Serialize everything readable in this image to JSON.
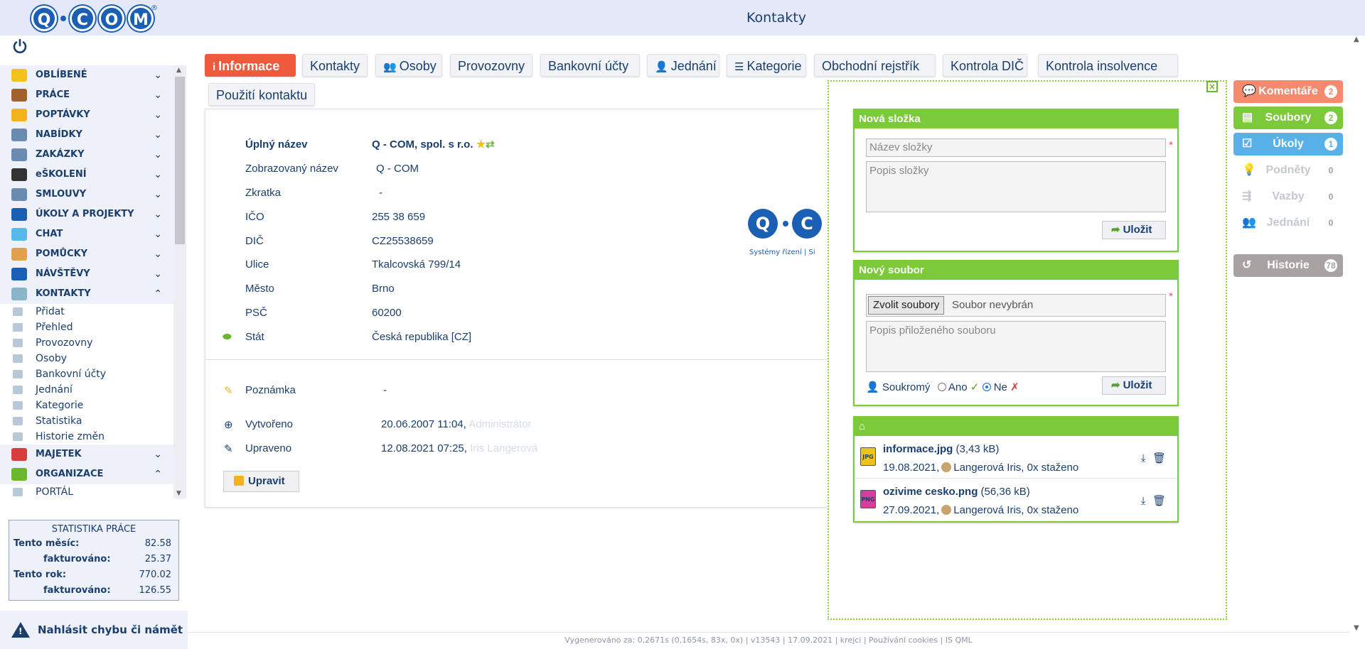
{
  "header": {
    "title": "Kontakty",
    "logo_text": "Q·COM"
  },
  "sidebar": {
    "items": [
      {
        "label": "OBLÍBENÉ",
        "icon": "star-icon",
        "color": "#f2c21c",
        "chev": "⌄"
      },
      {
        "label": "PRÁCE",
        "icon": "briefcase-icon",
        "color": "#a0622c",
        "chev": "⌄"
      },
      {
        "label": "POPTÁVKY",
        "icon": "bulb-icon",
        "color": "#f2b41c",
        "chev": "⌄"
      },
      {
        "label": "NABÍDKY",
        "icon": "clipboard-icon",
        "color": "#6a8ab0",
        "chev": "⌄"
      },
      {
        "label": "ZAKÁZKY",
        "icon": "toolbox-icon",
        "color": "#6a8ab0",
        "chev": "⌄"
      },
      {
        "label": "eŠKOLENÍ",
        "icon": "graduation-cap-icon",
        "color": "#333333",
        "chev": "⌄"
      },
      {
        "label": "SMLOUVY",
        "icon": "handshake-icon",
        "color": "#6a8ab0",
        "chev": "⌄"
      },
      {
        "label": "ÚKOLY A PROJEKTY",
        "icon": "task-icon",
        "color": "#1a5fb4",
        "chev": "⌄"
      },
      {
        "label": "CHAT",
        "icon": "chat-icon",
        "color": "#58b8e8",
        "chev": "⌄"
      },
      {
        "label": "POMŮCKY",
        "icon": "archive-icon",
        "color": "#e0a04c",
        "chev": "⌄"
      },
      {
        "label": "NÁVŠTĚVY",
        "icon": "walker-icon",
        "color": "#1a5fb4",
        "chev": "⌄"
      },
      {
        "label": "KONTAKTY",
        "icon": "contacts-icon",
        "color": "#8ab4c8",
        "chev": "⌃"
      }
    ],
    "kontakty_sub": [
      "Přidat",
      "Přehled",
      "Provozovny",
      "Osoby",
      "Bankovní účty",
      "Jednání",
      "Kategorie",
      "Statistika",
      "Historie změn"
    ],
    "items2": [
      {
        "label": "MAJETEK",
        "icon": "armchair-icon",
        "color": "#d83c3c",
        "chev": "⌄"
      },
      {
        "label": "ORGANIZACE",
        "icon": "cube-icon",
        "color": "#6cb82a",
        "chev": "⌃"
      }
    ],
    "org_sub": [
      "PORTÁL"
    ]
  },
  "stats": {
    "heading": "STATISTIKA PRÁCE",
    "month_label": "Tento měsíc:",
    "month_value": "82.58",
    "month_inv_label": "fakturováno:",
    "month_inv_value": "25.37",
    "year_label": "Tento rok:",
    "year_value": "770.02",
    "year_inv_label": "fakturováno:",
    "year_inv_value": "126.55"
  },
  "report": {
    "label": "Nahlásit chybu či námět"
  },
  "tabs": [
    {
      "label": "Informace",
      "icon": "i",
      "active": true
    },
    {
      "label": "Kontakty",
      "icon": ""
    },
    {
      "label": "Osoby",
      "icon": "👥"
    },
    {
      "label": "Provozovny",
      "icon": ""
    },
    {
      "label": "Bankovní účty",
      "icon": ""
    },
    {
      "label": "Jednání",
      "icon": "👤"
    },
    {
      "label": "Kategorie",
      "icon": "☰"
    },
    {
      "label": "Obchodní rejstřík",
      "icon": ""
    },
    {
      "label": "Kontrola DIČ",
      "icon": ""
    },
    {
      "label": "Kontrola insolvence",
      "icon": ""
    },
    {
      "label": "Použití kontaktu",
      "icon": ""
    }
  ],
  "info": {
    "full_name_label": "Úplný název",
    "full_name": "Q - COM, spol. s r.o.",
    "display_name_label": "Zobrazovaný název",
    "display_name": "Q - COM",
    "abbr_label": "Zkratka",
    "abbr": "-",
    "ico_label": "IČO",
    "ico": "255 38 659",
    "dic_label": "DIČ",
    "dic": "CZ25538659",
    "street_label": "Ulice",
    "street": "Tkalcovská 799/14",
    "city_label": "Město",
    "city": "Brno",
    "zip_label": "PSČ",
    "zip": "60200",
    "country_label": "Stát",
    "country": "Česká republika [CZ]",
    "logo_caption": "Systémy řízení | Si",
    "note_label": "Poznámka",
    "note": "-",
    "created_label": "Vytvořeno",
    "created": "20.06.2007 11:04,",
    "created_by": "Administrátor",
    "updated_label": "Upraveno",
    "updated": "12.08.2021 07:25,",
    "updated_by": "Iris Langerová",
    "edit_button": "Upravit"
  },
  "panel": {
    "new_folder": {
      "title": "Nová složka",
      "name_placeholder": "Název složky",
      "desc_placeholder": "Popis složky",
      "save": "Uložit"
    },
    "new_file": {
      "title": "Nový soubor",
      "choose": "Zvolit soubory",
      "no_file": "Soubor nevybrán",
      "desc_placeholder": "Popis přiloženého souboru",
      "private_label": "Soukromý",
      "yes": "Ano",
      "no": "Ne",
      "save": "Uložit"
    },
    "files": [
      {
        "name": "informace.jpg",
        "size": "(3,43 kB)",
        "date": "19.08.2021,",
        "user": "Langerová Iris, 0x staženo",
        "type": "JPG",
        "color": "#f2c21c"
      },
      {
        "name": "ozivime cesko.png",
        "size": "(56,36 kB)",
        "date": "27.09.2021,",
        "user": "Langerová Iris, 0x staženo",
        "type": "PNG",
        "color": "#d83c9c"
      }
    ]
  },
  "right_tabs": [
    {
      "label": "Komentáře",
      "count": "2",
      "color": "#f58a6e",
      "ghost": false,
      "icon": "comment-icon"
    },
    {
      "label": "Soubory",
      "count": "2",
      "color": "#7cc93a",
      "ghost": false,
      "icon": "file-icon"
    },
    {
      "label": "Úkoly",
      "count": "1",
      "color": "#58b0e8",
      "ghost": false,
      "icon": "task-icon"
    },
    {
      "label": "Podněty",
      "count": "0",
      "color": "#ffffff",
      "ghost": true,
      "icon": "bulb-icon"
    },
    {
      "label": "Vazby",
      "count": "0",
      "color": "#ffffff",
      "ghost": true,
      "icon": "link-icon"
    },
    {
      "label": "Jednání",
      "count": "0",
      "color": "#ffffff",
      "ghost": true,
      "icon": "people-icon"
    },
    {
      "label": "Historie",
      "count": "78",
      "color": "#a8a2a2",
      "ghost": false,
      "icon": "history-icon"
    }
  ],
  "footer": {
    "text": "Vygenerováno za: 0,2671s (0,1654s, 83x, 0x) | v13543 | 17.09.2021 | krejci | Používání cookies | IS QML"
  }
}
